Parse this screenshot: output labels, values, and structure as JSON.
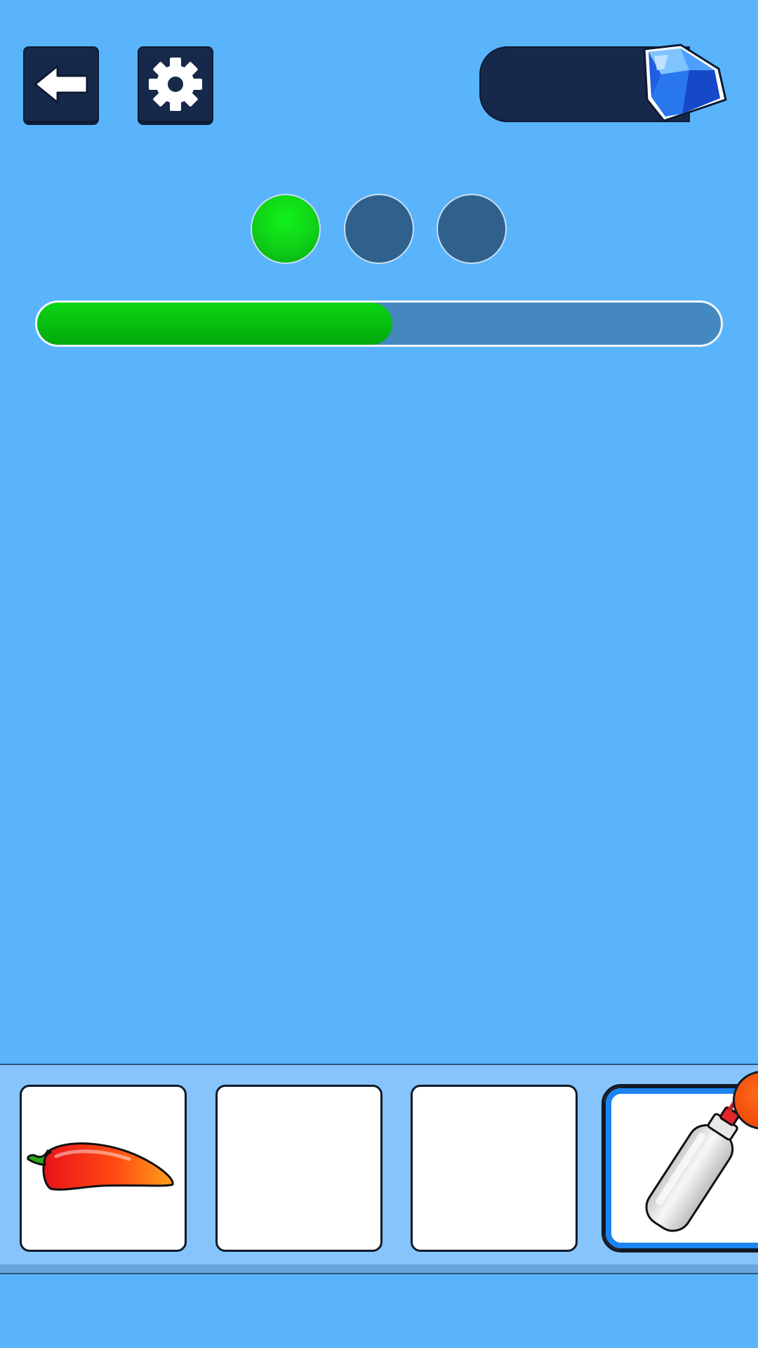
{
  "header": {
    "back_button": {
      "icon": "back-arrow-icon"
    },
    "settings_button": {
      "icon": "gear-icon"
    },
    "currency": {
      "value": "",
      "icon": "diamond-icon"
    }
  },
  "level": {
    "stages": [
      {
        "state": "completed"
      },
      {
        "state": "pending"
      },
      {
        "state": "pending"
      }
    ],
    "progress_fraction": 0.52
  },
  "inventory": {
    "slots": [
      {
        "item": "chili-pepper-icon",
        "selected": false
      },
      {
        "item": "",
        "selected": false
      },
      {
        "item": "",
        "selected": false
      },
      {
        "item": "squeeze-bottle-icon",
        "selected": true
      }
    ]
  },
  "colors": {
    "background": "#59b4fc",
    "dark_button": "#17294a",
    "progress_green": "#0bd613",
    "selected_slot": "#1b84f0"
  }
}
